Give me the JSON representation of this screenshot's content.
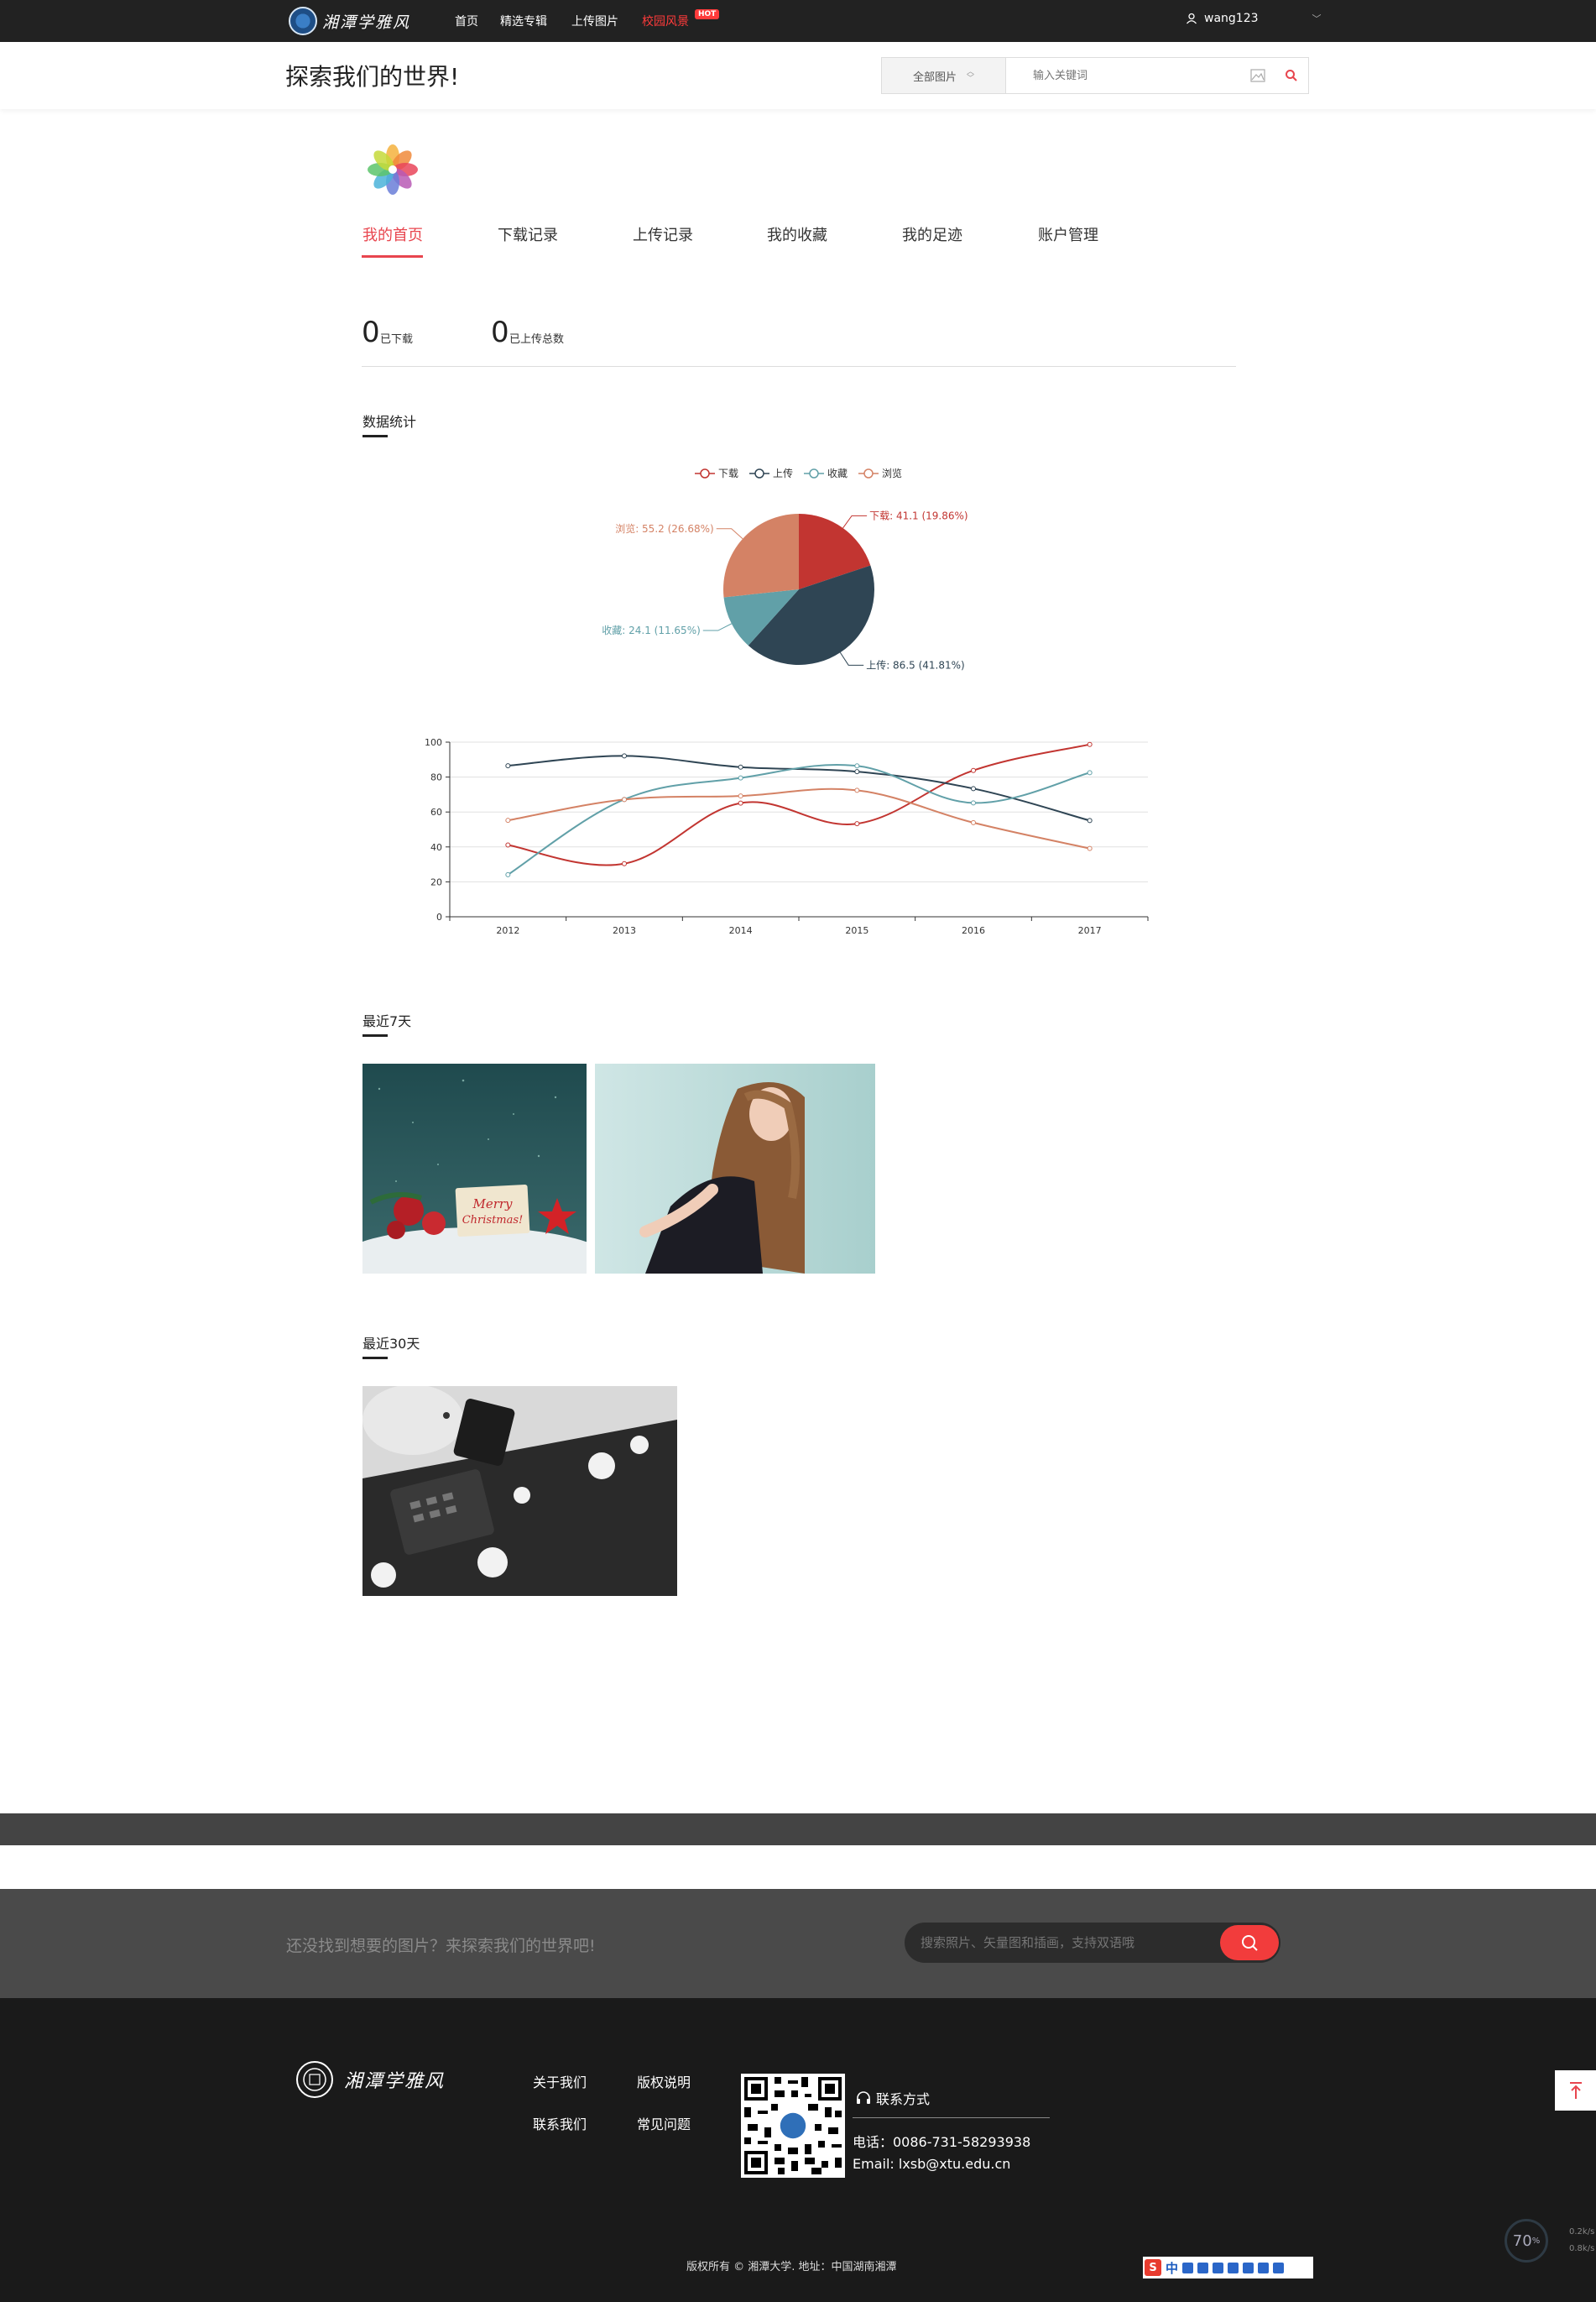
{
  "brand": {
    "logo_text": "湘潭学雅风"
  },
  "nav": {
    "items": [
      "首页",
      "精选专辑",
      "上传图片"
    ],
    "hot_item": "校园风景",
    "hot_badge": "HOT",
    "user": "wang123"
  },
  "header": {
    "title": "探索我们的世界!",
    "search_category": "全部图片",
    "search_placeholder": "输入关键词"
  },
  "profile": {
    "tabs": [
      "我的首页",
      "下载记录",
      "上传记录",
      "我的收藏",
      "我的足迹",
      "账户管理"
    ],
    "active_tab": 0,
    "stats": [
      {
        "value": "0",
        "label": "已下载"
      },
      {
        "value": "0",
        "label": "已上传总数"
      }
    ]
  },
  "sections": {
    "stats_title": "数据统计",
    "recent7_title": "最近7天",
    "recent30_title": "最近30天"
  },
  "colors": {
    "accent": "#e8454e",
    "download": "#c23531",
    "upload": "#2f4554",
    "favorite": "#61a0a8",
    "browse": "#d48265"
  },
  "chart_data": [
    {
      "type": "pie",
      "legend": [
        "下载",
        "上传",
        "收藏",
        "浏览"
      ],
      "legend_position": "top-center",
      "slices": [
        {
          "name": "下载",
          "value": 41.1,
          "percent": "19.86%"
        },
        {
          "name": "上传",
          "value": 86.5,
          "percent": "41.81%"
        },
        {
          "name": "收藏",
          "value": 24.1,
          "percent": "11.65%"
        },
        {
          "name": "浏览",
          "value": 55.2,
          "percent": "26.68%"
        }
      ],
      "labels": [
        "下载: 41.1 (19.86%)",
        "上传: 86.5 (41.81%)",
        "收藏: 24.1 (11.65%)",
        "浏览: 55.2 (26.68%)"
      ]
    },
    {
      "type": "line",
      "smooth": true,
      "categories": [
        "2012",
        "2013",
        "2014",
        "2015",
        "2016",
        "2017"
      ],
      "ylim": [
        0,
        100
      ],
      "yticks": [
        "0",
        "20",
        "40",
        "60",
        "80",
        "100"
      ],
      "grid": true,
      "series": [
        {
          "name": "下载",
          "values": [
            41.1,
            30.4,
            65.1,
            53.3,
            83.8,
            98.7
          ]
        },
        {
          "name": "上传",
          "values": [
            86.5,
            92.1,
            85.7,
            83.1,
            73.4,
            55.1
          ]
        },
        {
          "name": "收藏",
          "values": [
            24.1,
            67.2,
            79.5,
            86.4,
            65.2,
            82.5
          ]
        },
        {
          "name": "浏览",
          "values": [
            55.2,
            67.1,
            69.2,
            72.4,
            53.9,
            39.1
          ]
        }
      ]
    }
  ],
  "footer": {
    "band_text": "还没找到想要的图片？来探索我们的世界吧!",
    "search_placeholder": "搜索照片、矢量图和插画，支持双语哦",
    "links": [
      "关于我们",
      "版权说明",
      "联系我们",
      "常见问题"
    ],
    "contact_title": "联系方式",
    "phone": "电话：0086-731-58293938",
    "email": "Email: lxsb@xtu.edu.cn",
    "copyright": "版权所有 © 湘潭大学. 地址：中国湖南湘潭"
  },
  "overlay": {
    "speed_percent": "70",
    "speed_unit": "%",
    "speed_up": "0.2k/s",
    "speed_down": "0.8k/s",
    "ime_mode": "中"
  }
}
